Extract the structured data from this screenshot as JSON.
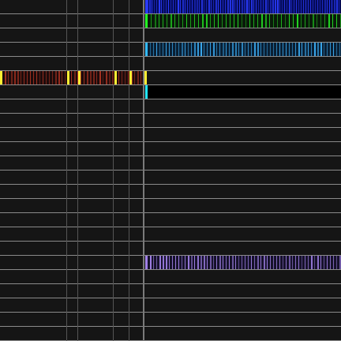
{
  "timeline": {
    "row_count": 24,
    "playhead_fraction": 0.42,
    "guide_fractions": [
      0.195,
      0.226,
      0.33,
      0.378
    ],
    "tracks": [
      {
        "id": "track-1",
        "row": 0,
        "start": 0.425,
        "end": 1.0,
        "color": "#0a1a9a",
        "tick_color": "#2a3cff",
        "bg": "#050a55",
        "tick_density": 3,
        "lead_color": "#2a3cff"
      },
      {
        "id": "track-2",
        "row": 1,
        "start": 0.425,
        "end": 1.0,
        "color": "#0b2a0b",
        "tick_color": "#22dd22",
        "bg": "#0a1a0a",
        "tick_density": 5,
        "lead_color": "#22ff22"
      },
      {
        "id": "track-3",
        "row": 3,
        "start": 0.425,
        "end": 1.0,
        "color": "#0a2a3a",
        "tick_color": "#3aa8ee",
        "bg": "#0a1f33",
        "tick_density": 4,
        "lead_color": "#33bbff"
      },
      {
        "id": "track-4",
        "row": 5,
        "start": 0.0,
        "end": 0.43,
        "color": "#2a0a0a",
        "tick_color": "#aa3322",
        "bg": "#1d0c0c",
        "tick_density": 4,
        "lead_color": "#ffee22",
        "markers": [
          0.0,
          0.197,
          0.23,
          0.335,
          0.38,
          0.425
        ],
        "marker_color": "#ffee33"
      },
      {
        "id": "track-5",
        "row": 6,
        "start": 0.425,
        "end": 1.0,
        "color": "#000000",
        "tick_color": "#000000",
        "bg": "#000000",
        "tick_density": 0,
        "lead_color": "#22e6ff"
      },
      {
        "id": "track-6",
        "row": 18,
        "start": 0.425,
        "end": 1.0,
        "color": "#1c1530",
        "tick_color": "#a080e6",
        "bg": "#16122a",
        "tick_density": 4,
        "lead_color": "#a080e6"
      }
    ]
  }
}
